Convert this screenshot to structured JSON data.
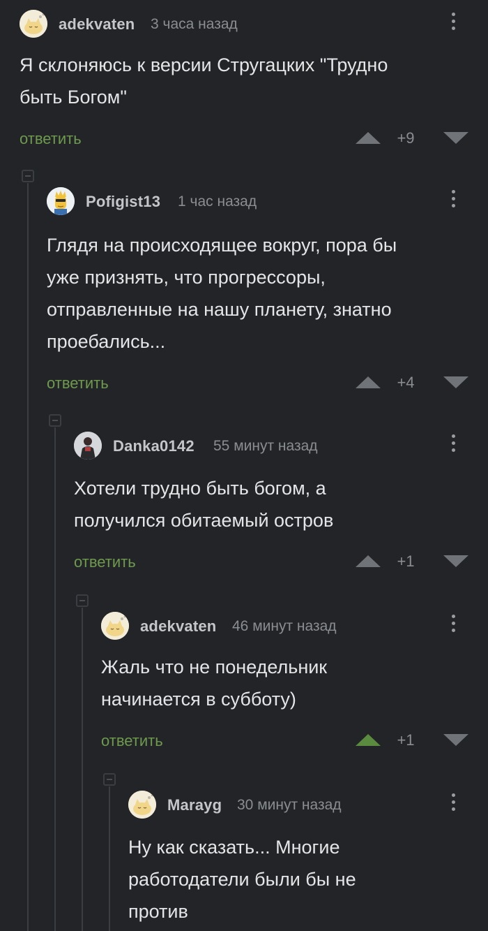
{
  "comments": [
    {
      "username": "adekvaten",
      "time": "3 часа назад",
      "text": "Я склоняюсь к версии Стругацких \"Трудно\nбыть Богом\"",
      "reply_label": "ответить",
      "score": "+9",
      "upvoted": false,
      "avatar_icon": "cat-sleeping-avatar"
    },
    {
      "username": "Pofigist13",
      "time": "1 час назад",
      "text": "Глядя на происходящее вокруг, пора бы\nуже признять, что прогрессоры,\nотправленные на нашу планету, знатно\nпроебались...",
      "reply_label": "ответить",
      "score": "+4",
      "upvoted": false,
      "avatar_icon": "simpson-character-avatar"
    },
    {
      "username": "Danka0142",
      "time": "55 минут назад",
      "text": "Хотели трудно быть богом, а\nполучился обитаемый остров",
      "reply_label": "ответить",
      "score": "+1",
      "upvoted": false,
      "avatar_icon": "person-photo-avatar"
    },
    {
      "username": "adekvaten",
      "time": "46 минут назад",
      "text": "Жаль что не понедельник\nначинается в субботу)",
      "reply_label": "ответить",
      "score": "+1",
      "upvoted": true,
      "avatar_icon": "cat-sleeping-avatar"
    },
    {
      "username": "Marayg",
      "time": "30 минут назад",
      "text": "Ну как сказать... Многие\nработодатели были бы не\nпротив",
      "avatar_icon": "cat-sleeping-avatar"
    }
  ],
  "colors": {
    "background": "#222427",
    "text": "#e4e5e7",
    "reply_link": "#6e9a4e",
    "upvote_active": "#5a8b3e",
    "muted": "#8a8d91"
  }
}
